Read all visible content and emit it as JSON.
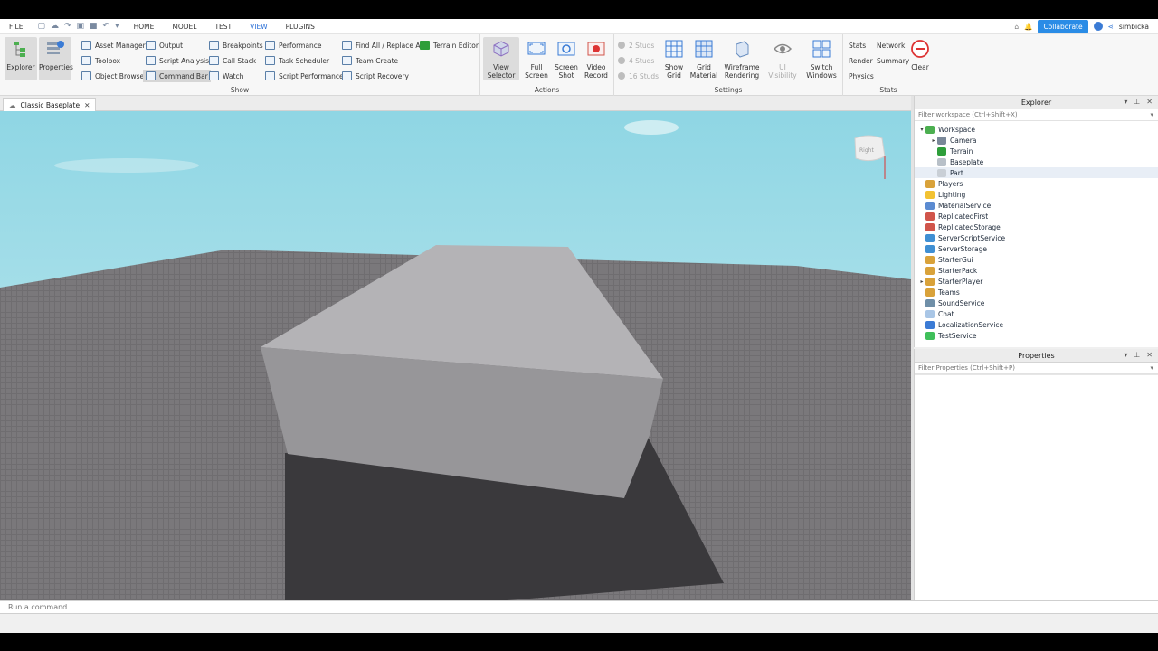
{
  "menu": {
    "file": "FILE",
    "tabs": [
      "HOME",
      "MODEL",
      "TEST",
      "VIEW",
      "PLUGINS"
    ],
    "active_tab": "VIEW",
    "collaborate": "Collaborate",
    "username": "simbicka"
  },
  "ribbon": {
    "show": {
      "explorer": "Explorer",
      "properties": "Properties",
      "asset_manager": "Asset Manager",
      "toolbox": "Toolbox",
      "object_browser": "Object Browser",
      "output": "Output",
      "script_analysis": "Script Analysis",
      "command_bar": "Command Bar",
      "breakpoints": "Breakpoints",
      "call_stack": "Call Stack",
      "watch": "Watch",
      "performance": "Performance",
      "task_scheduler": "Task Scheduler",
      "script_performance": "Script Performance",
      "find_replace": "Find All / Replace All",
      "team_create": "Team Create",
      "script_recovery": "Script Recovery",
      "terrain_editor": "Terrain Editor",
      "label": "Show"
    },
    "actions": {
      "view_selector": [
        "View",
        "Selector"
      ],
      "full_screen": [
        "Full",
        "Screen"
      ],
      "screen_shot": [
        "Screen",
        "Shot"
      ],
      "video_record": [
        "Video",
        "Record"
      ],
      "label": "Actions"
    },
    "settings": {
      "studs_2": "2 Studs",
      "studs_4": "4 Studs",
      "studs_16": "16 Studs",
      "show_grid": [
        "Show",
        "Grid"
      ],
      "grid_material": [
        "Grid",
        "Material"
      ],
      "wireframe": [
        "Wireframe",
        "Rendering"
      ],
      "ui_visibility": "UI Visibility",
      "switch_windows": [
        "Switch",
        "Windows"
      ],
      "label": "Settings"
    },
    "stats": {
      "stats": "Stats",
      "network": "Network",
      "render": "Render",
      "summary": "Summary",
      "physics": "Physics",
      "clear": "Clear",
      "label": "Stats"
    }
  },
  "document": {
    "tab_title": "Classic Baseplate"
  },
  "viewport": {
    "cube_label": "Right"
  },
  "explorer": {
    "title": "Explorer",
    "filter_placeholder": "Filter workspace (Ctrl+Shift+X)",
    "items": [
      {
        "label": "Workspace",
        "depth": 0,
        "expander": "▾",
        "color": "#4caf50",
        "hover": false
      },
      {
        "label": "Camera",
        "depth": 1,
        "expander": "▸",
        "color": "#7a8899",
        "hover": false
      },
      {
        "label": "Terrain",
        "depth": 1,
        "expander": "",
        "color": "#2e9e3a",
        "hover": false
      },
      {
        "label": "Baseplate",
        "depth": 1,
        "expander": "",
        "color": "#b8c0c8",
        "hover": false
      },
      {
        "label": "Part",
        "depth": 1,
        "expander": "",
        "color": "#c9cfd6",
        "hover": true
      },
      {
        "label": "Players",
        "depth": 0,
        "expander": "",
        "color": "#d9a23a",
        "hover": false
      },
      {
        "label": "Lighting",
        "depth": 0,
        "expander": "",
        "color": "#f2c232",
        "hover": false
      },
      {
        "label": "MaterialService",
        "depth": 0,
        "expander": "",
        "color": "#5b8bd1",
        "hover": false
      },
      {
        "label": "ReplicatedFirst",
        "depth": 0,
        "expander": "",
        "color": "#d0554b",
        "hover": false
      },
      {
        "label": "ReplicatedStorage",
        "depth": 0,
        "expander": "",
        "color": "#d0554b",
        "hover": false
      },
      {
        "label": "ServerScriptService",
        "depth": 0,
        "expander": "",
        "color": "#3f8fd3",
        "hover": false
      },
      {
        "label": "ServerStorage",
        "depth": 0,
        "expander": "",
        "color": "#3f8fd3",
        "hover": false
      },
      {
        "label": "StarterGui",
        "depth": 0,
        "expander": "",
        "color": "#d9a23a",
        "hover": false
      },
      {
        "label": "StarterPack",
        "depth": 0,
        "expander": "",
        "color": "#d9a23a",
        "hover": false
      },
      {
        "label": "StarterPlayer",
        "depth": 0,
        "expander": "▸",
        "color": "#d9a23a",
        "hover": false
      },
      {
        "label": "Teams",
        "depth": 0,
        "expander": "",
        "color": "#d9a23a",
        "hover": false
      },
      {
        "label": "SoundService",
        "depth": 0,
        "expander": "",
        "color": "#6f8fa8",
        "hover": false
      },
      {
        "label": "Chat",
        "depth": 0,
        "expander": "",
        "color": "#a9c6e6",
        "hover": false
      },
      {
        "label": "LocalizationService",
        "depth": 0,
        "expander": "",
        "color": "#3b7bd5",
        "hover": false
      },
      {
        "label": "TestService",
        "depth": 0,
        "expander": "",
        "color": "#3fbf5a",
        "hover": false
      }
    ]
  },
  "properties": {
    "title": "Properties",
    "filter_placeholder": "Filter Properties (Ctrl+Shift+P)"
  },
  "command_bar": {
    "placeholder": "Run a command"
  },
  "colors": {
    "accent": "#2a8ce6",
    "sky": "#8fd6e4",
    "baseplate": "#7a787b",
    "part": "#a3a2a5"
  }
}
